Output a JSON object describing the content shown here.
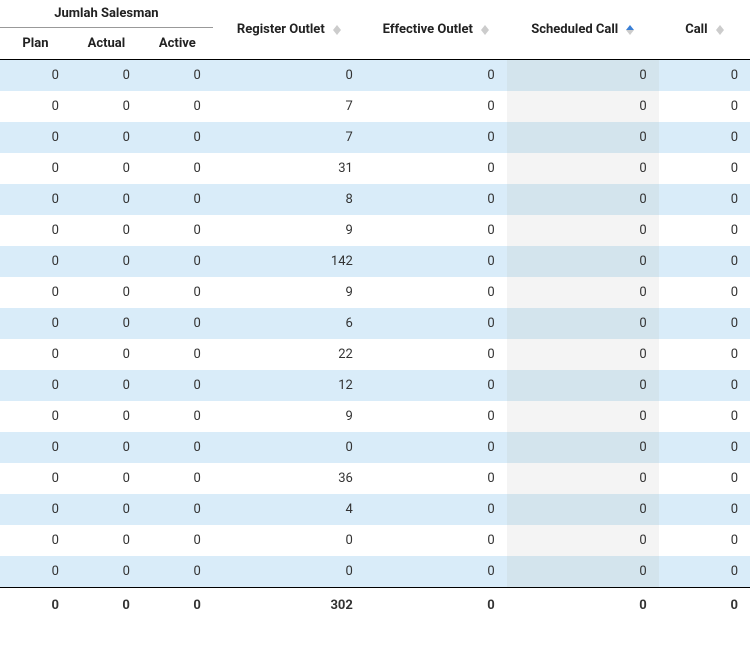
{
  "headers": {
    "group_salesman": "Jumlah Salesman",
    "plan": "Plan",
    "actual": "Actual",
    "active": "Active",
    "register_outlet": "Register Outlet",
    "effective_outlet": "Effective Outlet",
    "scheduled_call": "Scheduled Call",
    "call": "Call"
  },
  "sort": {
    "column": "scheduled_call",
    "direction": "asc"
  },
  "rows": [
    {
      "plan": 0,
      "actual": 0,
      "active": 0,
      "register_outlet": 0,
      "effective_outlet": 0,
      "scheduled_call": 0,
      "call": 0
    },
    {
      "plan": 0,
      "actual": 0,
      "active": 0,
      "register_outlet": 7,
      "effective_outlet": 0,
      "scheduled_call": 0,
      "call": 0
    },
    {
      "plan": 0,
      "actual": 0,
      "active": 0,
      "register_outlet": 7,
      "effective_outlet": 0,
      "scheduled_call": 0,
      "call": 0
    },
    {
      "plan": 0,
      "actual": 0,
      "active": 0,
      "register_outlet": 31,
      "effective_outlet": 0,
      "scheduled_call": 0,
      "call": 0
    },
    {
      "plan": 0,
      "actual": 0,
      "active": 0,
      "register_outlet": 8,
      "effective_outlet": 0,
      "scheduled_call": 0,
      "call": 0
    },
    {
      "plan": 0,
      "actual": 0,
      "active": 0,
      "register_outlet": 9,
      "effective_outlet": 0,
      "scheduled_call": 0,
      "call": 0
    },
    {
      "plan": 0,
      "actual": 0,
      "active": 0,
      "register_outlet": 142,
      "effective_outlet": 0,
      "scheduled_call": 0,
      "call": 0
    },
    {
      "plan": 0,
      "actual": 0,
      "active": 0,
      "register_outlet": 9,
      "effective_outlet": 0,
      "scheduled_call": 0,
      "call": 0
    },
    {
      "plan": 0,
      "actual": 0,
      "active": 0,
      "register_outlet": 6,
      "effective_outlet": 0,
      "scheduled_call": 0,
      "call": 0
    },
    {
      "plan": 0,
      "actual": 0,
      "active": 0,
      "register_outlet": 22,
      "effective_outlet": 0,
      "scheduled_call": 0,
      "call": 0
    },
    {
      "plan": 0,
      "actual": 0,
      "active": 0,
      "register_outlet": 12,
      "effective_outlet": 0,
      "scheduled_call": 0,
      "call": 0
    },
    {
      "plan": 0,
      "actual": 0,
      "active": 0,
      "register_outlet": 9,
      "effective_outlet": 0,
      "scheduled_call": 0,
      "call": 0
    },
    {
      "plan": 0,
      "actual": 0,
      "active": 0,
      "register_outlet": 0,
      "effective_outlet": 0,
      "scheduled_call": 0,
      "call": 0
    },
    {
      "plan": 0,
      "actual": 0,
      "active": 0,
      "register_outlet": 36,
      "effective_outlet": 0,
      "scheduled_call": 0,
      "call": 0
    },
    {
      "plan": 0,
      "actual": 0,
      "active": 0,
      "register_outlet": 4,
      "effective_outlet": 0,
      "scheduled_call": 0,
      "call": 0
    },
    {
      "plan": 0,
      "actual": 0,
      "active": 0,
      "register_outlet": 0,
      "effective_outlet": 0,
      "scheduled_call": 0,
      "call": 0
    },
    {
      "plan": 0,
      "actual": 0,
      "active": 0,
      "register_outlet": 0,
      "effective_outlet": 0,
      "scheduled_call": 0,
      "call": 0
    }
  ],
  "totals": {
    "plan": 0,
    "actual": 0,
    "active": 0,
    "register_outlet": 302,
    "effective_outlet": 0,
    "scheduled_call": 0,
    "call": 0
  }
}
